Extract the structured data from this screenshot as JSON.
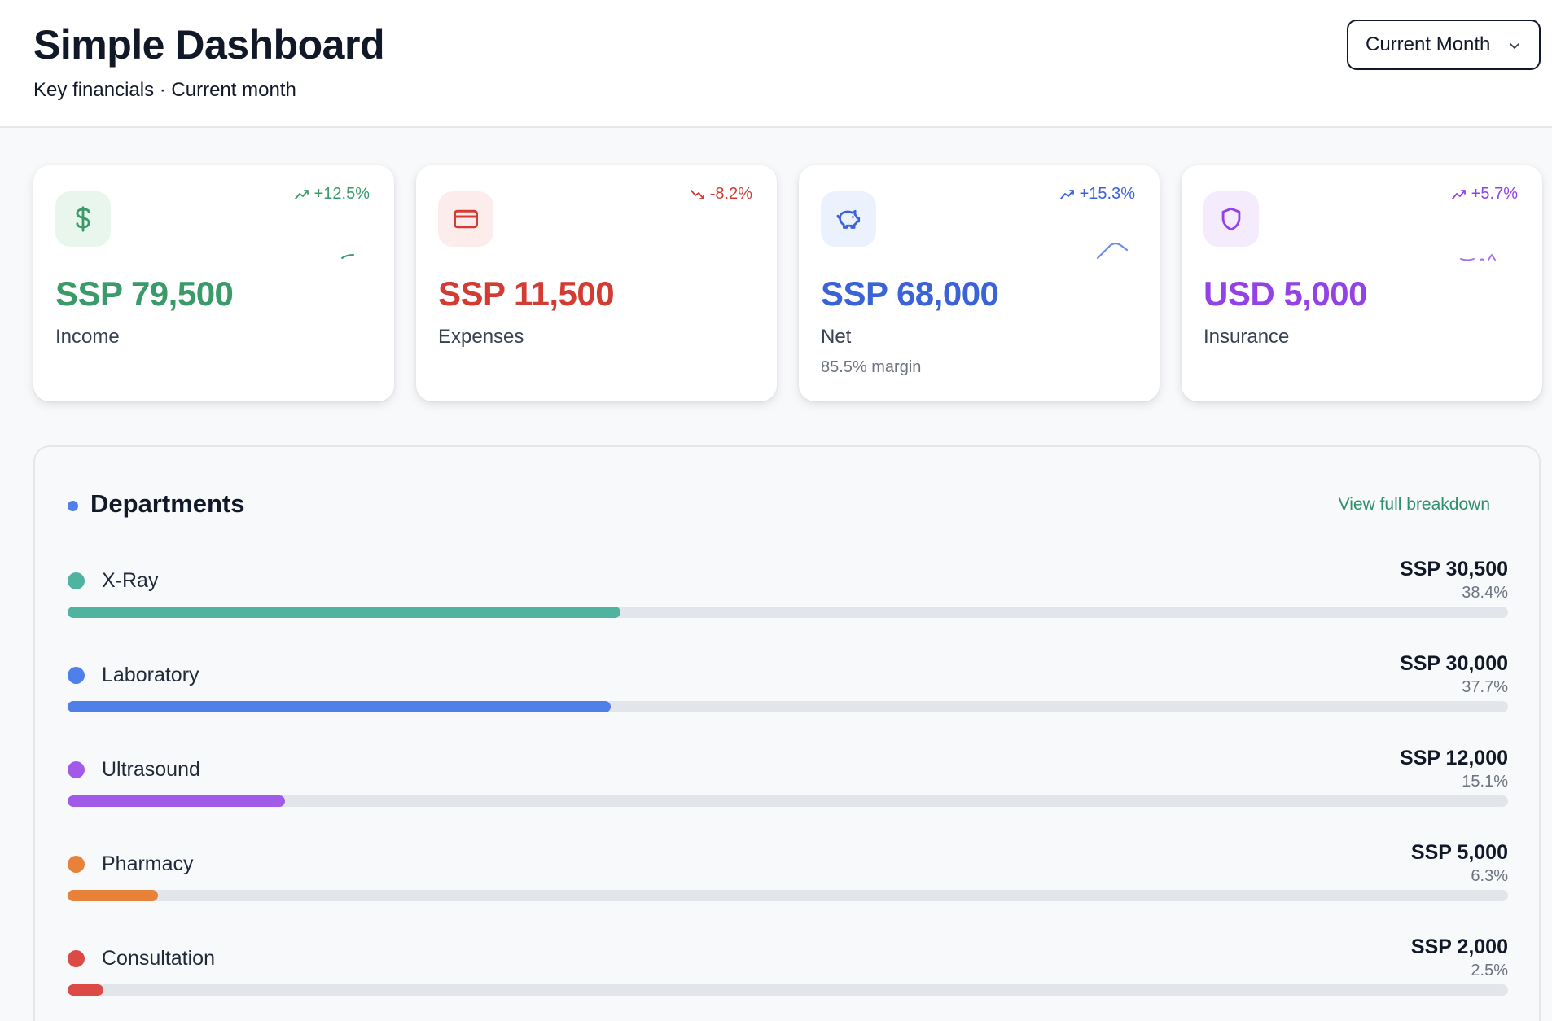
{
  "header": {
    "title": "Simple Dashboard",
    "subtitle": "Key financials · Current month",
    "period_select": {
      "value": "Current Month",
      "icon": "chevron-down-icon"
    }
  },
  "cards": [
    {
      "amount": "SSP 79,500",
      "label": "Income",
      "trend": "+12.5%",
      "trend_dir": "up",
      "icon": "dollar-icon",
      "color": "#3a9a6a",
      "icon_bg": "#e8f6ee",
      "sub": ""
    },
    {
      "amount": "SSP 11,500",
      "label": "Expenses",
      "trend": "-8.2%",
      "trend_dir": "down",
      "icon": "credit-card-icon",
      "color": "#d23c32",
      "icon_bg": "#fdecec",
      "sub": ""
    },
    {
      "amount": "SSP 68,000",
      "label": "Net",
      "trend": "+15.3%",
      "trend_dir": "up",
      "icon": "piggy-bank-icon",
      "color": "#3b63d8",
      "icon_bg": "#ebf1fd",
      "sub": "85.5% margin"
    },
    {
      "amount": "USD 5,000",
      "label": "Insurance",
      "trend": "+5.7%",
      "trend_dir": "up",
      "icon": "shield-icon",
      "color": "#9342e6",
      "icon_bg": "#f4ecfd",
      "sub": ""
    }
  ],
  "departments": {
    "title": "Departments",
    "link": "View full breakdown",
    "items": [
      {
        "name": "X-Ray",
        "value": "SSP 30,500",
        "pct": "38.4%",
        "share": 0.384,
        "color": "#4fb3a0"
      },
      {
        "name": "Laboratory",
        "value": "SSP 30,000",
        "pct": "37.7%",
        "share": 0.377,
        "color": "#4f7fe8"
      },
      {
        "name": "Ultrasound",
        "value": "SSP 12,000",
        "pct": "15.1%",
        "share": 0.151,
        "color": "#a15be8"
      },
      {
        "name": "Pharmacy",
        "value": "SSP 5,000",
        "pct": "6.3%",
        "share": 0.063,
        "color": "#e8823a"
      },
      {
        "name": "Consultation",
        "value": "SSP 2,000",
        "pct": "2.5%",
        "share": 0.025,
        "color": "#dc4a45"
      }
    ]
  }
}
